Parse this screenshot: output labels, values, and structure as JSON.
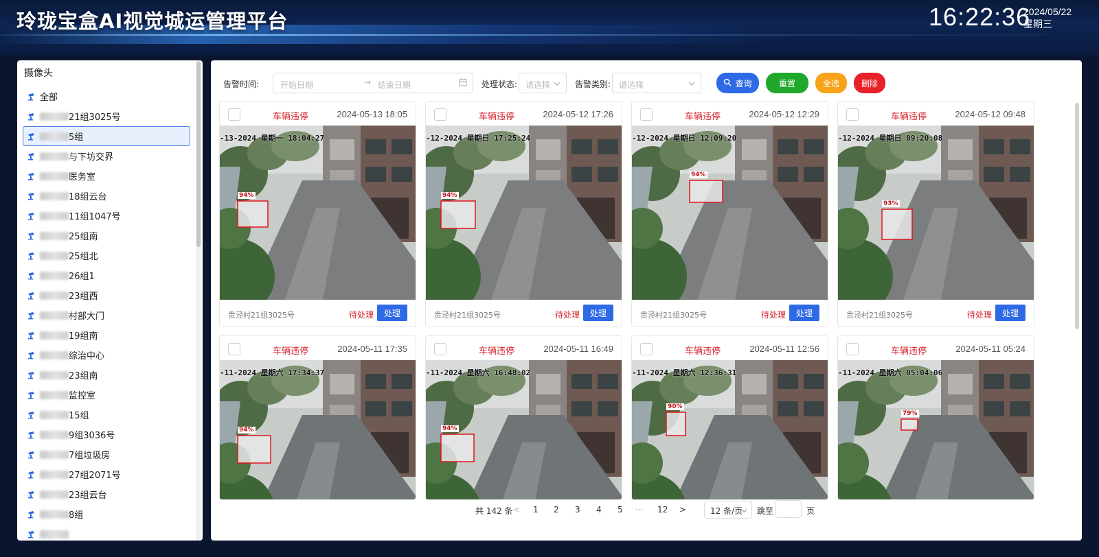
{
  "header": {
    "title": "玲珑宝盒AI视觉城运管理平台",
    "time": "16:22:36",
    "date": "2024/05/22",
    "weekday": "星期三"
  },
  "sidebar": {
    "title": "摄像头",
    "items": [
      {
        "label": "全部",
        "blurred": false
      },
      {
        "label": "21组3025号",
        "blurred": true
      },
      {
        "label": "5组",
        "blurred": true,
        "active": true
      },
      {
        "label": "与下坊交界",
        "blurred": true
      },
      {
        "label": "医务室",
        "blurred": true
      },
      {
        "label": "18组云台",
        "blurred": true
      },
      {
        "label": "11组1047号",
        "blurred": true
      },
      {
        "label": "25组南",
        "blurred": true
      },
      {
        "label": "25组北",
        "blurred": true
      },
      {
        "label": "26组1",
        "blurred": true
      },
      {
        "label": "23组西",
        "blurred": true
      },
      {
        "label": "村部大门",
        "blurred": true
      },
      {
        "label": "19组南",
        "blurred": true
      },
      {
        "label": "综治中心",
        "blurred": true
      },
      {
        "label": "23组南",
        "blurred": true
      },
      {
        "label": "监控室",
        "blurred": true
      },
      {
        "label": "15组",
        "blurred": true
      },
      {
        "label": "9组3036号",
        "blurred": true
      },
      {
        "label": "7组垃圾房",
        "blurred": true
      },
      {
        "label": "27组2071号",
        "blurred": true
      },
      {
        "label": "23组云台",
        "blurred": true
      },
      {
        "label": "8组",
        "blurred": true
      },
      {
        "label": "",
        "blurred": true
      }
    ]
  },
  "filters": {
    "time_label": "告警时间:",
    "start_placeholder": "开始日期",
    "end_placeholder": "结束日期",
    "status_label": "处理状态:",
    "status_placeholder": "请选择",
    "category_label": "告警类别:",
    "category_placeholder": "请选择",
    "query": "查询",
    "reset": "重置",
    "select_all": "全选",
    "delete": "删除"
  },
  "cards": [
    {
      "type": "车辆违停",
      "time": "2024-05-13 18:05",
      "overlay": "-13-2024 星期一 18:04:27",
      "conf": "94%",
      "location": "贵泾村21组3025号",
      "status": "待处理",
      "action": "处理"
    },
    {
      "type": "车辆违停",
      "time": "2024-05-12 17:26",
      "overlay": "-12-2024 星期日 17:25:24",
      "conf": "94%",
      "location": "贵泾村21组3025号",
      "status": "待处理",
      "action": "处理"
    },
    {
      "type": "车辆违停",
      "time": "2024-05-12 12:29",
      "overlay": "-12-2024 星期日 12:09:20",
      "conf": "94%",
      "location": "贵泾村21组3025号",
      "status": "待处理",
      "action": "处理"
    },
    {
      "type": "车辆违停",
      "time": "2024-05-12 09:48",
      "overlay": "-12-2024 星期日 09:20:08",
      "conf": "93%",
      "location": "贵泾村21组3025号",
      "status": "待处理",
      "action": "处理"
    },
    {
      "type": "车辆违停",
      "time": "2024-05-11 17:35",
      "overlay": "-11-2024 星期六 17:34:37",
      "conf": "94%",
      "location": "",
      "status": "",
      "action": ""
    },
    {
      "type": "车辆违停",
      "time": "2024-05-11 16:49",
      "overlay": "-11-2024 星期六 16:48:02",
      "conf": "94%",
      "location": "",
      "status": "",
      "action": ""
    },
    {
      "type": "车辆违停",
      "time": "2024-05-11 12:56",
      "overlay": "-11-2024 星期六 12:36:31",
      "conf": "90%",
      "location": "",
      "status": "",
      "action": ""
    },
    {
      "type": "车辆违停",
      "time": "2024-05-11 05:24",
      "overlay": "-11-2024 星期六 05:04:06",
      "conf": "79%",
      "location": "",
      "status": "",
      "action": ""
    }
  ],
  "pager": {
    "total": "共 142 条",
    "prev": "<",
    "pages": [
      "1",
      "2",
      "3",
      "4",
      "5",
      "···",
      "12"
    ],
    "next": ">",
    "page_size": "12 条/页",
    "jump_label": "跳至",
    "jump_suffix": "页"
  }
}
